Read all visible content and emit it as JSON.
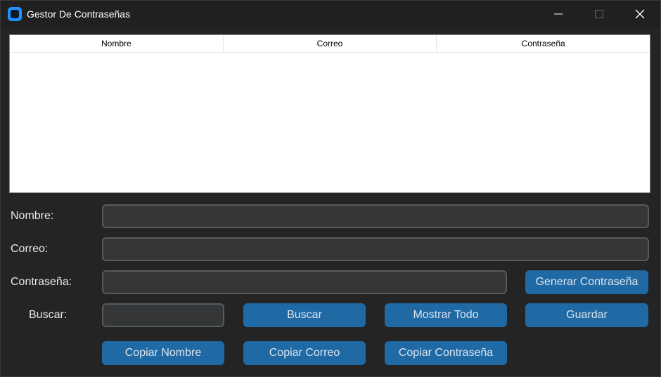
{
  "window": {
    "title": "Gestor De Contraseñas",
    "accent": "#1f6aa5"
  },
  "table": {
    "columns": [
      "Nombre",
      "Correo",
      "Contraseña"
    ],
    "rows": []
  },
  "form": {
    "nombre_label": "Nombre:",
    "nombre_value": "",
    "correo_label": "Correo:",
    "correo_value": "",
    "contrasena_label": "Contraseña:",
    "contrasena_value": "",
    "buscar_label": "Buscar:",
    "buscar_value": ""
  },
  "buttons": {
    "generar": "Generar Contraseña",
    "buscar": "Buscar",
    "mostrar_todo": "Mostrar Todo",
    "guardar": "Guardar",
    "copiar_nombre": "Copiar Nombre",
    "copiar_correo": "Copiar Correo",
    "copiar_contrasena": "Copiar Contraseña"
  }
}
